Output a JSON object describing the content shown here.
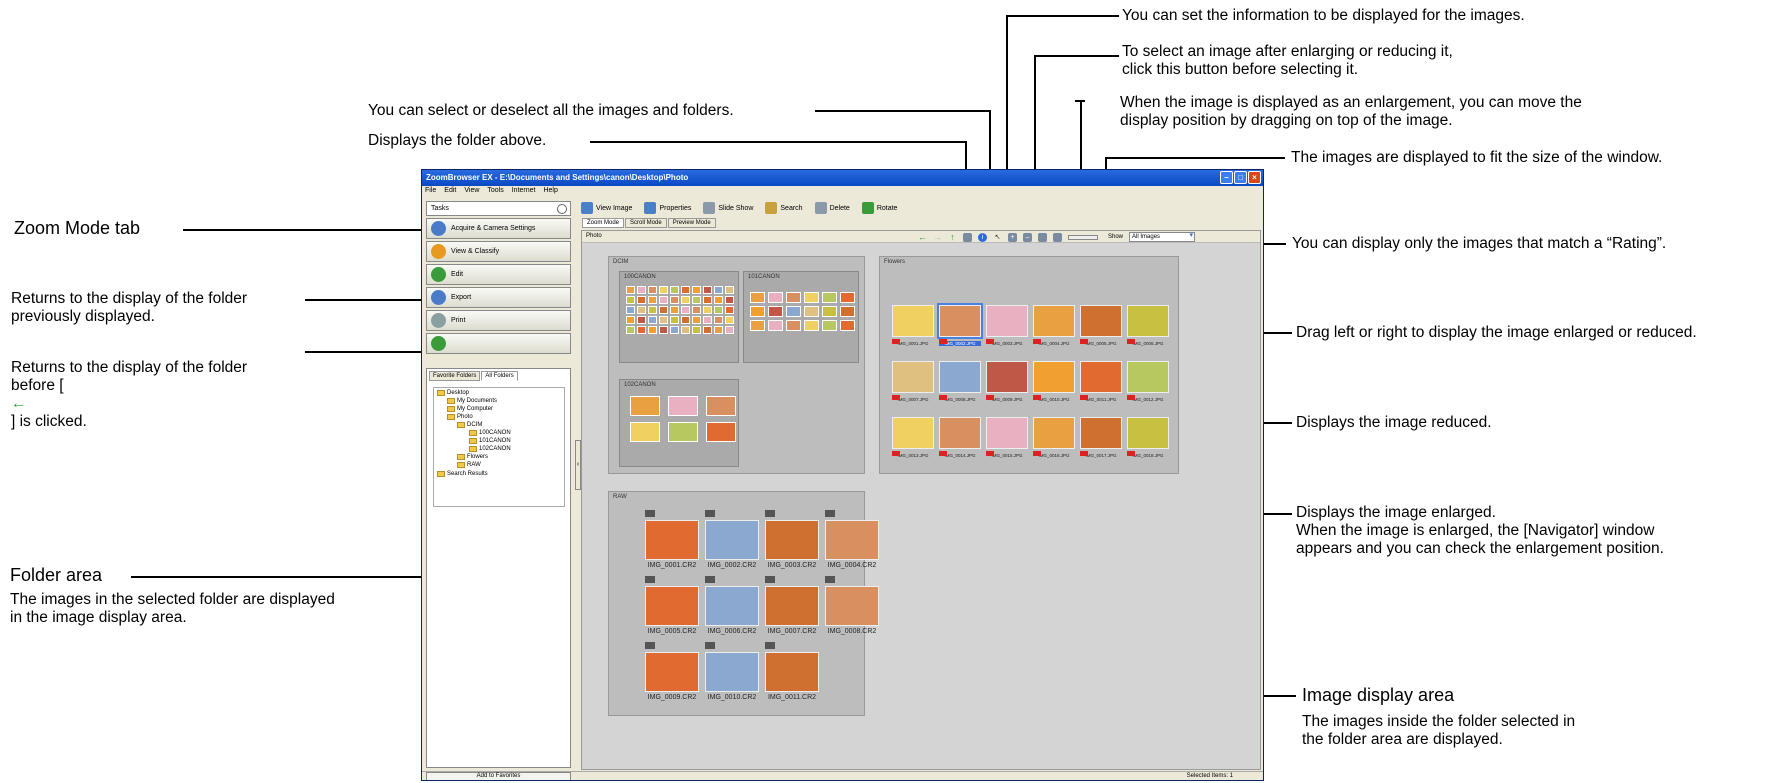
{
  "callouts": {
    "info_settings": "You can set the information to be displayed for the images.",
    "select_after_zoom": "To select an image after enlarging or reducing it,\nclick this button before selecting it.",
    "drag_move": "When the image is displayed as an enlargement, you can move the\ndisplay position by dragging on top of the image.",
    "select_all": "You can select or deselect all the images and folders.",
    "folder_above": "Displays the folder above.",
    "fit_window": "The images are displayed to fit the size of the window.",
    "zoom_mode_tab": "Zoom Mode tab",
    "rating_filter": "You can display only the images that match a “Rating”.",
    "back": "Returns to the display of the folder\npreviously displayed.",
    "forward_pre": "Returns to the display of the folder\nbefore [",
    "forward_post": "] is clicked.",
    "zoom_slider": "Drag left or right to display the image enlarged or reduced.",
    "zoom_out": "Displays the image reduced.",
    "zoom_in": "Displays the image enlarged.\nWhen the image is enlarged, the [Navigator] window\nappears and you can check the enlargement position.",
    "folder_area_title": "Folder area",
    "folder_area_desc": "The images in the selected folder are displayed\nin the image display area.",
    "image_area_title": "Image display area",
    "image_area_desc": "The images inside the folder selected in\nthe folder area are displayed."
  },
  "window": {
    "title": "ZoomBrowser EX  -  E:\\Documents and Settings\\canon\\Desktop\\Photo",
    "menu": [
      "File",
      "Edit",
      "View",
      "Tools",
      "Internet",
      "Help"
    ],
    "tasks_label": "Tasks",
    "tasks": [
      "Acquire & Camera Settings",
      "View & Classify",
      "Edit",
      "Export",
      "Print",
      ""
    ],
    "folder_tabs": [
      "Favorite Folders",
      "All Folders"
    ],
    "tree": [
      "Desktop",
      "My Documents",
      "My Computer",
      "Photo",
      "DCIM",
      "100CANON",
      "101CANON",
      "102CANON",
      "Flowers",
      "RAW",
      "Search Results"
    ],
    "add_favorites": "Add to Favorites",
    "toolbar": [
      "View Image",
      "Properties",
      "Slide Show",
      "Search",
      "Delete",
      "Rotate"
    ],
    "mode_tabs": [
      "Zoom Mode",
      "Scroll Mode",
      "Preview Mode"
    ],
    "photo_label": "Photo",
    "show_label": "Show",
    "show_value": "All Images",
    "status": "Selected Items: 1"
  },
  "groups": {
    "dcim": "DCIM",
    "sub1": "100CANON",
    "sub2": "101CANON",
    "sub3": "102CANON",
    "flowers": "Flowers",
    "raw": "RAW"
  },
  "raw_files": [
    "IMG_0001.CR2",
    "IMG_0002.CR2",
    "IMG_0003.CR2",
    "IMG_0004.CR2",
    "IMG_0005.CR2",
    "IMG_0006.CR2",
    "IMG_0007.CR2",
    "IMG_0008.CR2",
    "IMG_0009.CR2",
    "IMG_0010.CR2",
    "IMG_0011.CR2"
  ],
  "flower_files": [
    "IMG_0001.JPG",
    "IMG_0002.JPG",
    "IMG_0003.JPG",
    "IMG_0004.JPG",
    "IMG_0005.JPG",
    "IMG_0006.JPG",
    "IMG_0007.JPG",
    "IMG_0008.JPG",
    "IMG_0009.JPG",
    "IMG_0010.JPG",
    "IMG_0011.JPG",
    "IMG_0012.JPG",
    "IMG_0013.JPG",
    "IMG_0014.JPG",
    "IMG_0015.JPG",
    "IMG_0016.JPG",
    "IMG_0017.JPG",
    "IMG_0018.JPG"
  ],
  "flower_selected_index": 1,
  "icon_names": [
    "back-arrow-icon",
    "forward-arrow-icon",
    "folder-up-icon",
    "select-all-icon",
    "info-icon",
    "select-pointer-icon",
    "zoom-in-icon",
    "zoom-out-icon",
    "hand-icon",
    "fit-window-icon"
  ]
}
